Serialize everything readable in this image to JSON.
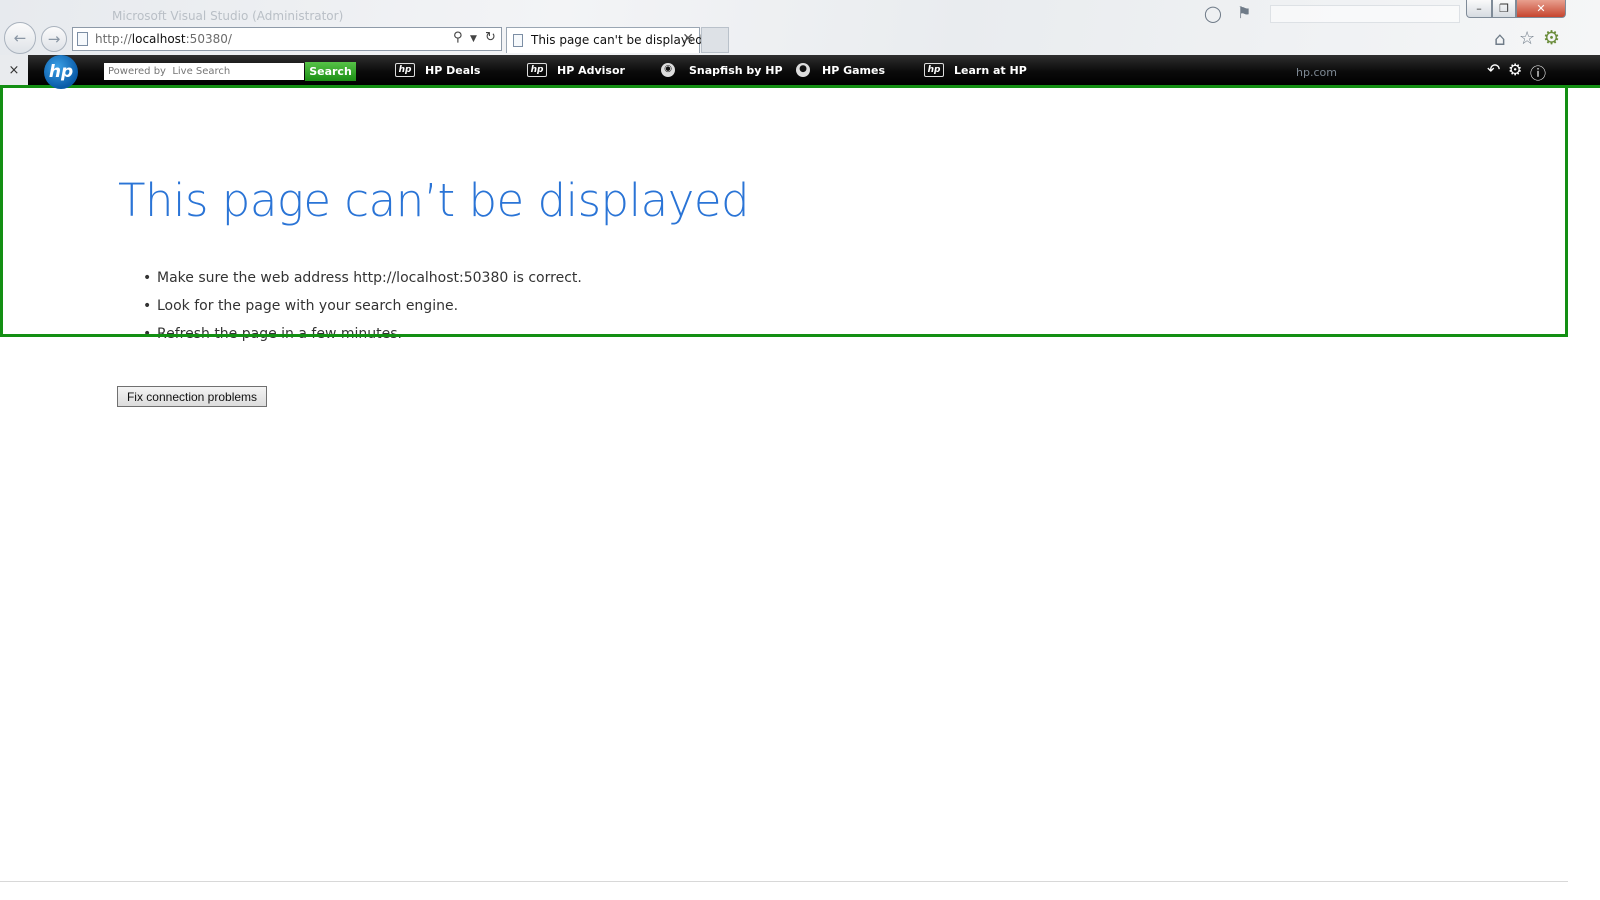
{
  "window": {
    "title": "Microsoft Visual Studio (Administrator)",
    "controls": {
      "minimize": "–",
      "maximize": "❐",
      "close": "✕"
    }
  },
  "navigation": {
    "back_icon": "back-arrow-icon",
    "forward_icon": "forward-arrow-icon"
  },
  "address_bar": {
    "url_prefix": "http://",
    "url_host": "localhost",
    "url_rest": ":50380/"
  },
  "tabs": [
    {
      "label": "This page can't be displayed",
      "close": "✕"
    }
  ],
  "hp_toolbar": {
    "close": "×",
    "logo_text": "hp",
    "search_placeholder": "Powered by  Live Search",
    "search_button": "Search",
    "links": [
      {
        "label": "HP Deals",
        "icon": "hp-logo-icon"
      },
      {
        "label": "HP Advisor",
        "icon": "hp-logo-icon"
      },
      {
        "label": "Snapfish by HP",
        "icon": "camera-icon"
      },
      {
        "label": "HP Games",
        "icon": "games-icon"
      },
      {
        "label": "Learn at HP",
        "icon": "hp-logo-icon"
      }
    ],
    "site_link": "hp.com"
  },
  "page": {
    "heading": "This page can’t be displayed",
    "tips": [
      "Make sure the web address http://localhost:50380 is correct.",
      "Look for the page with your search engine.",
      "Refresh the page in a few minutes."
    ],
    "fix_button": "Fix connection problems"
  },
  "colors": {
    "accent_green": "#138f13",
    "heading_blue": "#2a74d6",
    "toolbar_black": "#0b0b0b"
  }
}
